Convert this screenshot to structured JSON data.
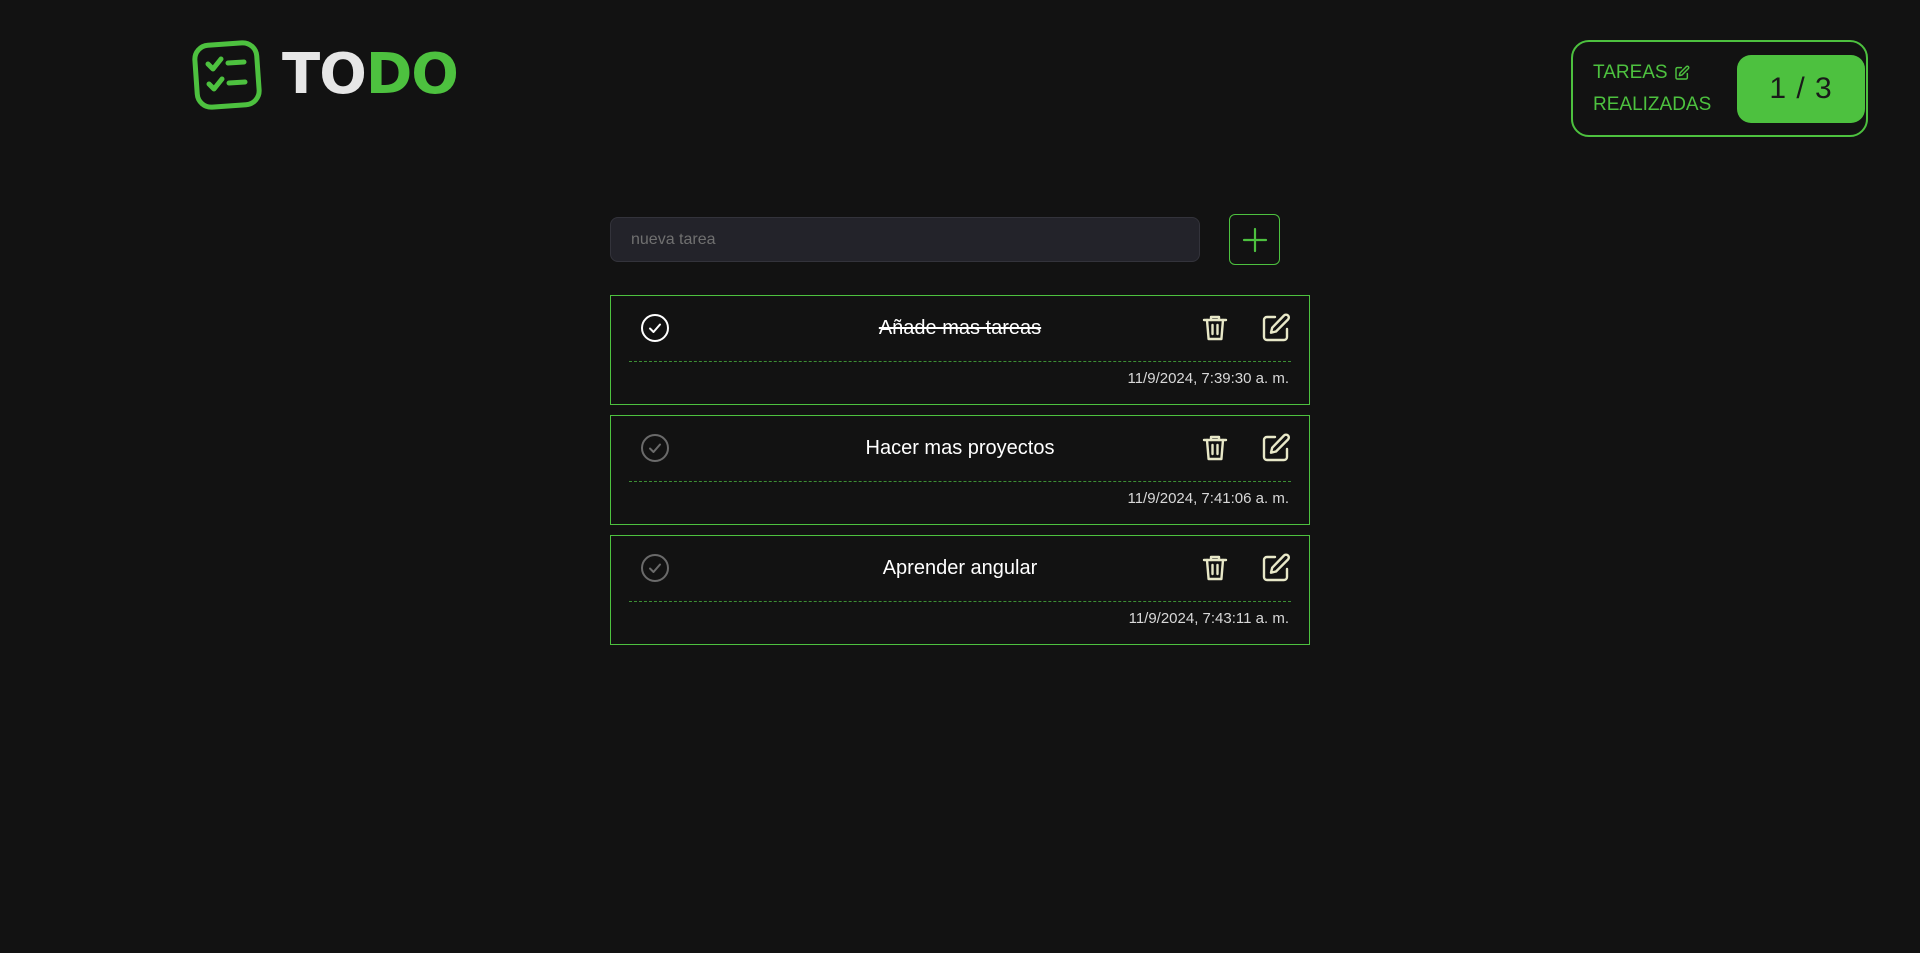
{
  "header": {
    "logo_text_1": "TO",
    "logo_text_2": "DO",
    "logo_icon": "checklist-icon"
  },
  "counter": {
    "label_line1": "TAREAS",
    "label_line2": "REALIZADAS",
    "edit_icon": "edit-icon",
    "value": "1 / 3",
    "completed": 1,
    "total": 3
  },
  "new_task": {
    "placeholder": "nueva tarea",
    "value": "",
    "add_icon": "plus-icon"
  },
  "tasks": [
    {
      "title": "Añade mas tareas",
      "date": "11/9/2024, 7:39:30 a. m.",
      "done": true
    },
    {
      "title": "Hacer mas proyectos",
      "date": "11/9/2024, 7:41:06 a. m.",
      "done": false
    },
    {
      "title": "Aprender angular",
      "date": "11/9/2024, 7:43:11 a. m.",
      "done": false
    }
  ],
  "colors": {
    "background": "#121212",
    "accent": "#4dc13f",
    "check_done": "#ffffff",
    "check_pending": "#6a6a6a",
    "action_icon": "#e8e8c8"
  }
}
